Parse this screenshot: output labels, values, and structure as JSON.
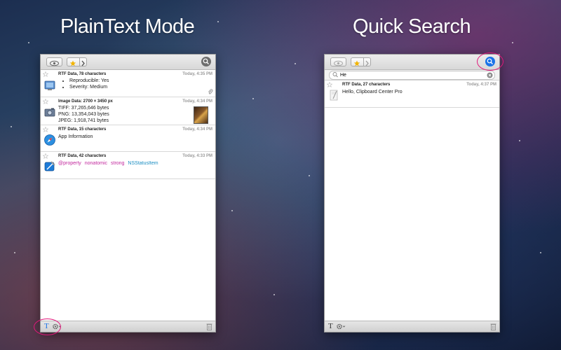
{
  "left_panel": {
    "heading": "PlainText Mode",
    "items": [
      {
        "title": "RTF Data, 78 characters",
        "time": "Today, 4:35 PM",
        "bullets": [
          "Reproducible: Yes",
          "Severity: Medium"
        ],
        "icon": "preview-app-icon",
        "attachment": "paperclip-icon"
      },
      {
        "title": "Image Data: 2700 × 3450 px",
        "time": "Today, 4:34 PM",
        "lines": [
          "TIFF: 37,265,646 bytes",
          "PNG: 13,354,043 bytes",
          "JPEG: 1,918,741 bytes"
        ],
        "icon": "image-capture-icon",
        "thumbnail": "image-thumbnail"
      },
      {
        "title": "RTF Data, 15 characters",
        "time": "Today, 4:34 PM",
        "text": "App Information",
        "icon": "safari-icon"
      },
      {
        "title": "RTF Data, 42 characters",
        "time": "Today, 4:33 PM",
        "code": [
          "@property",
          "nonatomic",
          "strong",
          "NSStatusItem"
        ],
        "icon": "xcode-icon"
      }
    ],
    "bottom": {
      "mode_glyph": "T"
    }
  },
  "right_panel": {
    "heading": "Quick Search",
    "search": {
      "value": "He",
      "placeholder": ""
    },
    "items": [
      {
        "title": "RTF Data, 27 characters",
        "time": "Today, 4:37 PM",
        "text": "Hello, Clipboard Center Pro",
        "icon": "textedit-icon"
      }
    ],
    "bottom": {
      "mode_glyph": "T"
    }
  },
  "colors": {
    "highlight_ring": "#e0187a",
    "search_active": "#1a73e8",
    "keyword_magenta": "#c2279d",
    "keyword_blue": "#1a8ec2"
  }
}
